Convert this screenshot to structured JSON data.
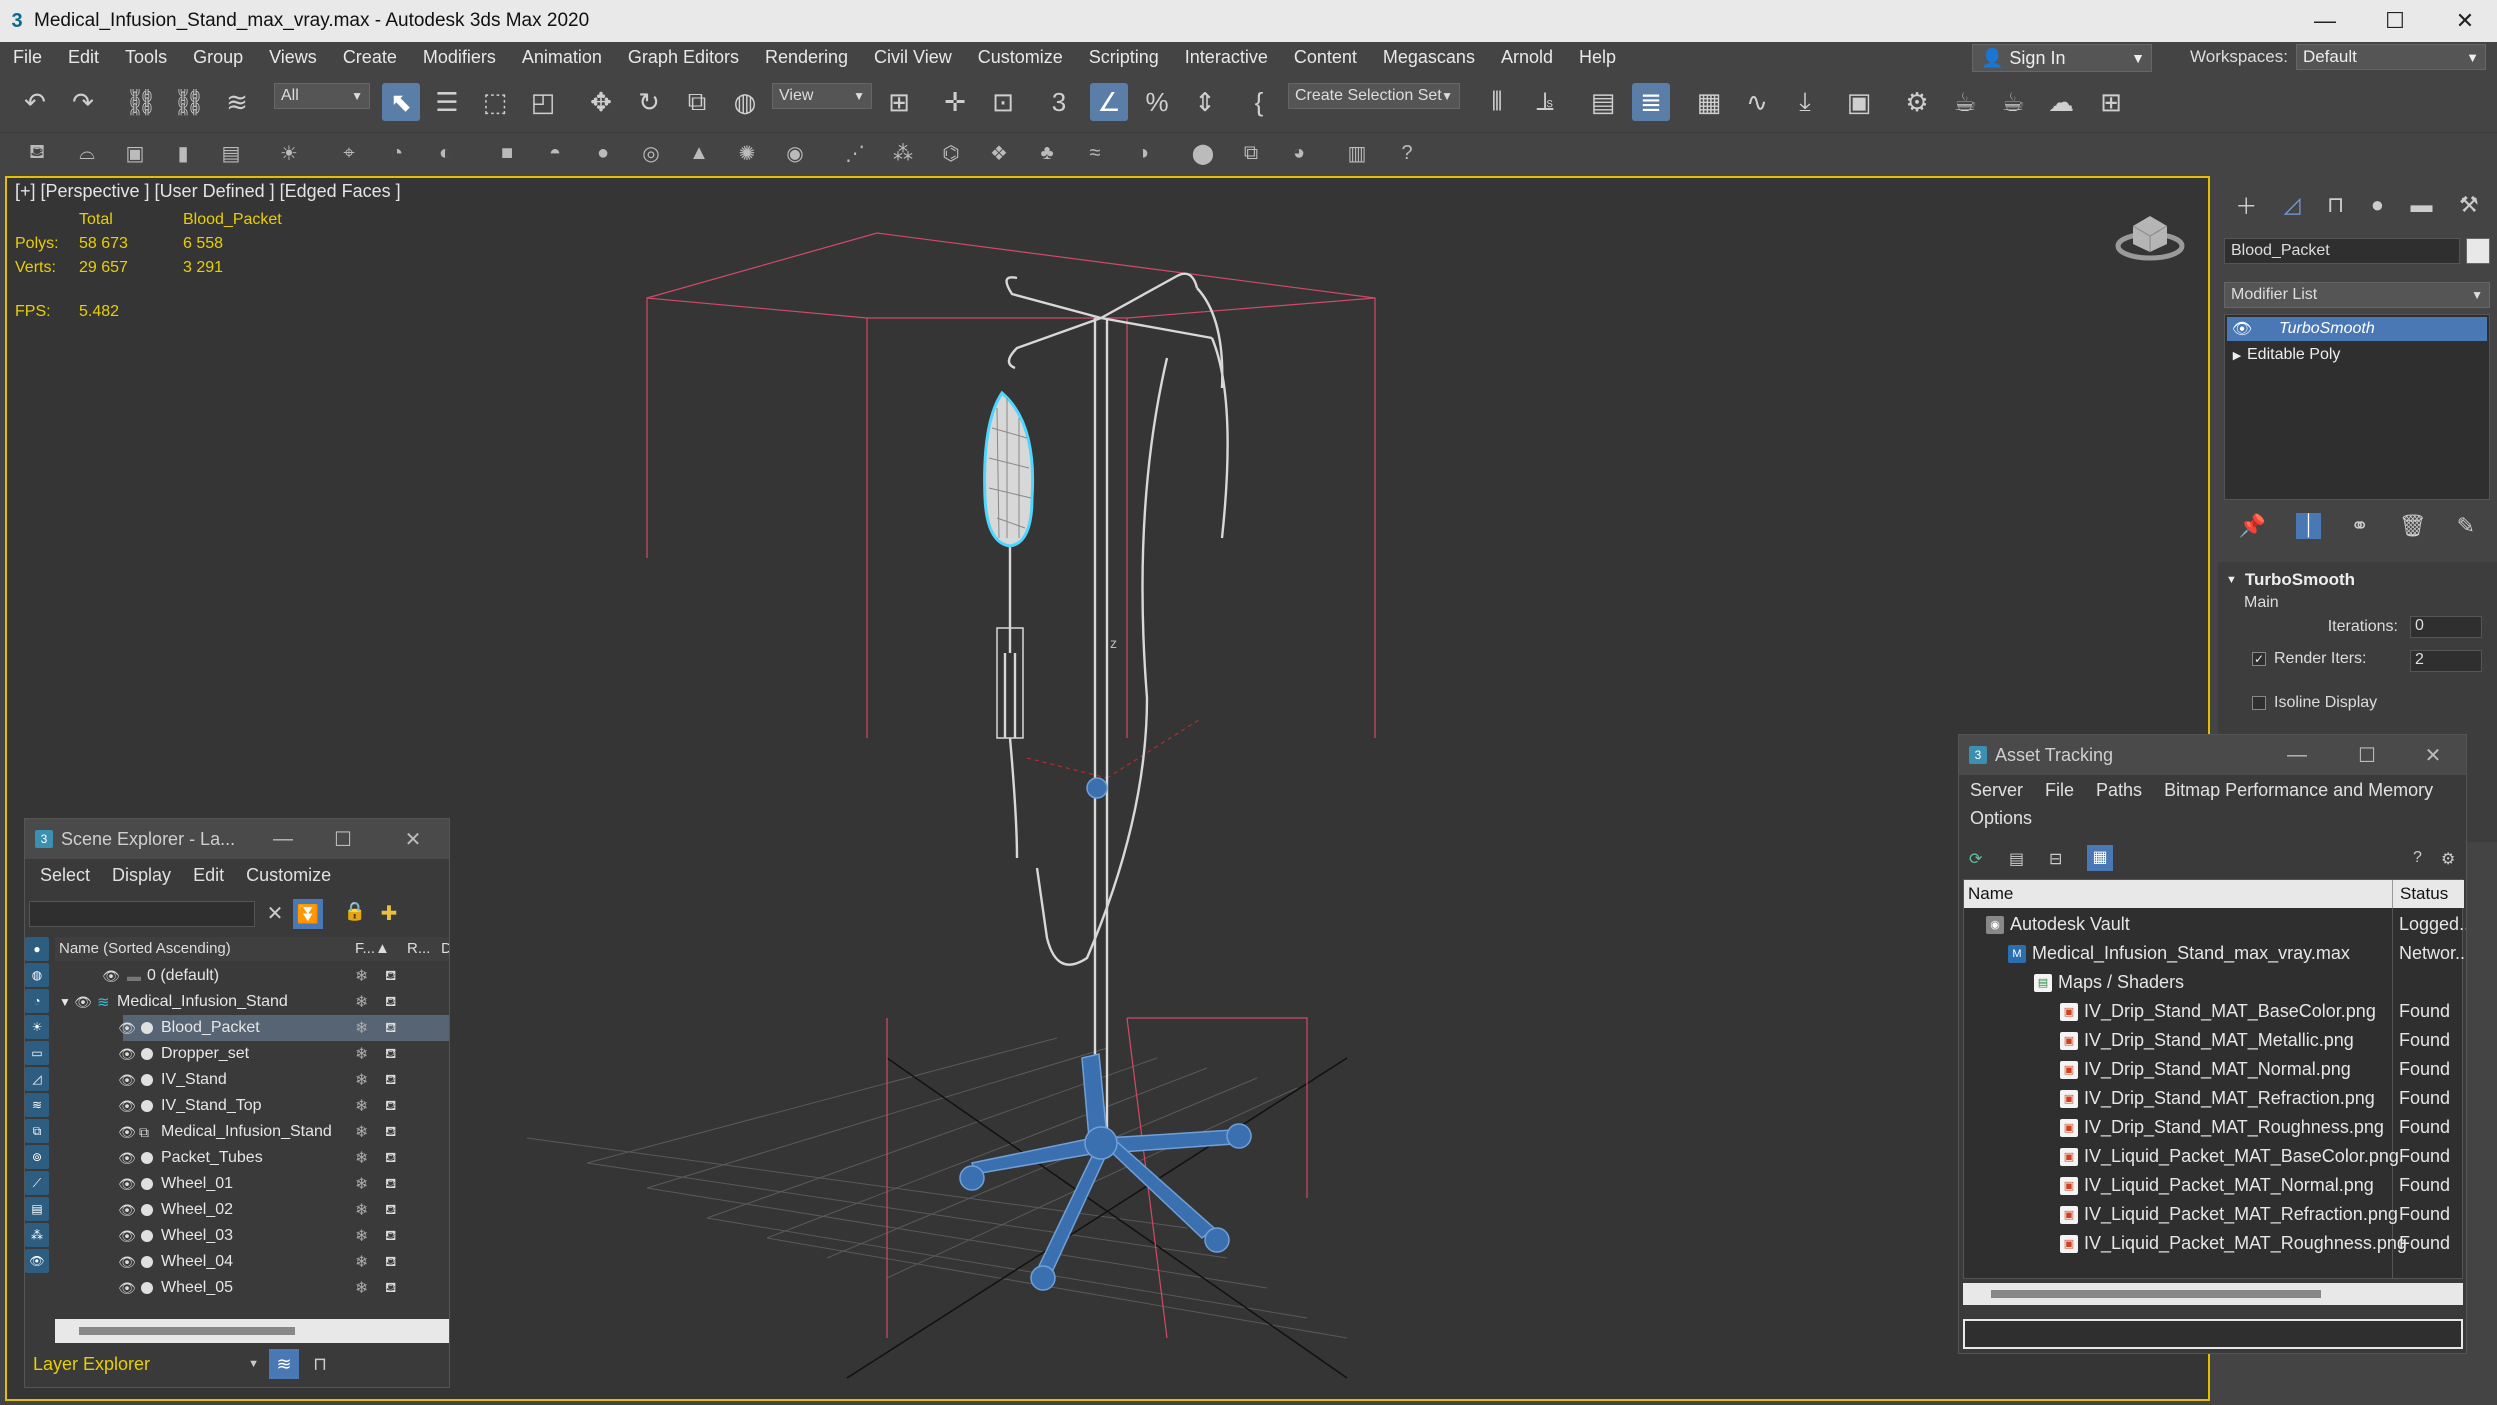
{
  "window": {
    "title": "Medical_Infusion_Stand_max_vray.max - Autodesk 3ds Max 2020",
    "minimize": "—",
    "maximize": "☐",
    "close": "✕"
  },
  "menu": [
    "File",
    "Edit",
    "Tools",
    "Group",
    "Views",
    "Create",
    "Modifiers",
    "Animation",
    "Graph Editors",
    "Rendering",
    "Civil View",
    "Customize",
    "Scripting",
    "Interactive",
    "Content",
    "Megascans",
    "Arnold",
    "Help"
  ],
  "signin": {
    "label": "Sign In"
  },
  "workspaces": {
    "label": "Workspaces:",
    "value": "Default"
  },
  "toolbar": {
    "filter_value": "All",
    "ref_coord": "View",
    "selection_set": "Create Selection Set"
  },
  "viewport": {
    "label": "[+] [Perspective ] [User Defined ] [Edged Faces ]",
    "stats": {
      "col_total": "Total",
      "col_sel": "Blood_Packet",
      "polys_label": "Polys:",
      "polys_total": "58 673",
      "polys_sel": "6 558",
      "verts_label": "Verts:",
      "verts_total": "29 657",
      "verts_sel": "3 291"
    },
    "fps_label": "FPS:",
    "fps_value": "5.482",
    "axis_label": "z"
  },
  "command_panel": {
    "object_name": "Blood_Packet",
    "modifier_list": "Modifier List",
    "stack": [
      "TurboSmooth",
      "Editable Poly"
    ],
    "rollout_title": "TurboSmooth",
    "group_main": "Main",
    "iterations_label": "Iterations:",
    "iterations_value": "0",
    "render_iters_label": "Render Iters:",
    "render_iters_value": "2",
    "isoline_label": "Isoline Display"
  },
  "scene_explorer": {
    "title": "Scene Explorer - La...",
    "menu": [
      "Select",
      "Display",
      "Edit",
      "Customize"
    ],
    "col_name": "Name (Sorted Ascending)",
    "col_frozen": "F...▲",
    "col_render": "R...",
    "col_disp": "Disp",
    "rows": [
      "0 (default)",
      "Medical_Infusion_Stand",
      "Blood_Packet",
      "Dropper_set",
      "IV_Stand",
      "IV_Stand_Top",
      "Medical_Infusion_Stand",
      "Packet_Tubes",
      "Wheel_01",
      "Wheel_02",
      "Wheel_03",
      "Wheel_04",
      "Wheel_05"
    ],
    "footer": "Layer Explorer"
  },
  "asset_tracking": {
    "title": "Asset Tracking",
    "menu": [
      "Server",
      "File",
      "Paths",
      "Bitmap Performance and Memory"
    ],
    "menu2": "Options",
    "col_name": "Name",
    "col_status": "Status",
    "rows": [
      {
        "name": "Autodesk Vault",
        "status": "Logged..."
      },
      {
        "name": "Medical_Infusion_Stand_max_vray.max",
        "status": "Networ..."
      },
      {
        "name": "Maps / Shaders",
        "status": ""
      },
      {
        "name": "IV_Drip_Stand_MAT_BaseColor.png",
        "status": "Found"
      },
      {
        "name": "IV_Drip_Stand_MAT_Metallic.png",
        "status": "Found"
      },
      {
        "name": "IV_Drip_Stand_MAT_Normal.png",
        "status": "Found"
      },
      {
        "name": "IV_Drip_Stand_MAT_Refraction.png",
        "status": "Found"
      },
      {
        "name": "IV_Drip_Stand_MAT_Roughness.png",
        "status": "Found"
      },
      {
        "name": "IV_Liquid_Packet_MAT_BaseColor.png",
        "status": "Found"
      },
      {
        "name": "IV_Liquid_Packet_MAT_Normal.png",
        "status": "Found"
      },
      {
        "name": "IV_Liquid_Packet_MAT_Refraction.png",
        "status": "Found"
      },
      {
        "name": "IV_Liquid_Packet_MAT_Roughness.png",
        "status": "Found"
      }
    ]
  },
  "colors": {
    "accent": "#5a7ea8",
    "selection_yellow": "#e8d000",
    "viewport_bg": "#353535",
    "wire": "#d8d8d8",
    "wire_selected": "#3a6fb0",
    "highlight": "#4fd6ff"
  }
}
